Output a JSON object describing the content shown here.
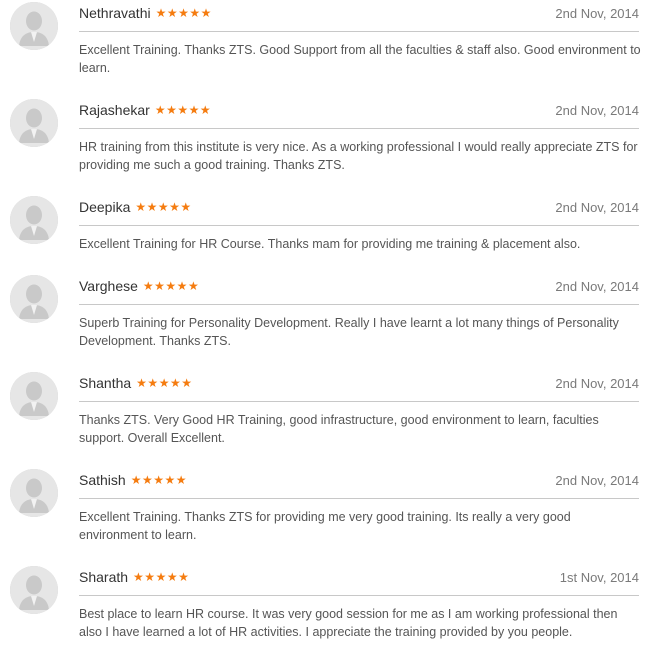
{
  "reviews": [
    {
      "name": "Nethravathi",
      "stars": "★★★★★",
      "date": "2nd Nov, 2014",
      "text": "Excellent Training. Thanks ZTS. Good Support from all the faculties & staff also. Good environment to learn."
    },
    {
      "name": "Rajashekar",
      "stars": "★★★★★",
      "date": "2nd Nov, 2014",
      "text": "HR training from this institute is very nice. As a working professional I would really appreciate ZTS for providing me such a good training. Thanks ZTS."
    },
    {
      "name": "Deepika",
      "stars": "★★★★★",
      "date": "2nd Nov, 2014",
      "text": "Excellent Training for HR Course. Thanks mam for providing me training & placement also."
    },
    {
      "name": "Varghese",
      "stars": "★★★★★",
      "date": "2nd Nov, 2014",
      "text": "Superb Training for Personality Development. Really I have learnt a lot many things of Personality Development. Thanks ZTS."
    },
    {
      "name": "Shantha",
      "stars": "★★★★★",
      "date": "2nd Nov, 2014",
      "text": "Thanks ZTS. Very Good HR Training, good infrastructure, good environment to learn, faculties support. Overall Excellent."
    },
    {
      "name": "Sathish",
      "stars": "★★★★★",
      "date": "2nd Nov, 2014",
      "text": "Excellent Training. Thanks ZTS for providing me very good training. Its really a very good environment to learn."
    },
    {
      "name": "Sharath",
      "stars": "★★★★★",
      "date": "1st Nov, 2014",
      "text": "Best place to learn HR course. It was very good session for me as I am working professional then also I have learned a lot of HR activities. I appreciate the training provided by you people."
    }
  ],
  "rating": {
    "max": 5,
    "value": 5,
    "color": "#f57c10"
  },
  "icons": {
    "avatar": "user-silhouette-icon"
  }
}
